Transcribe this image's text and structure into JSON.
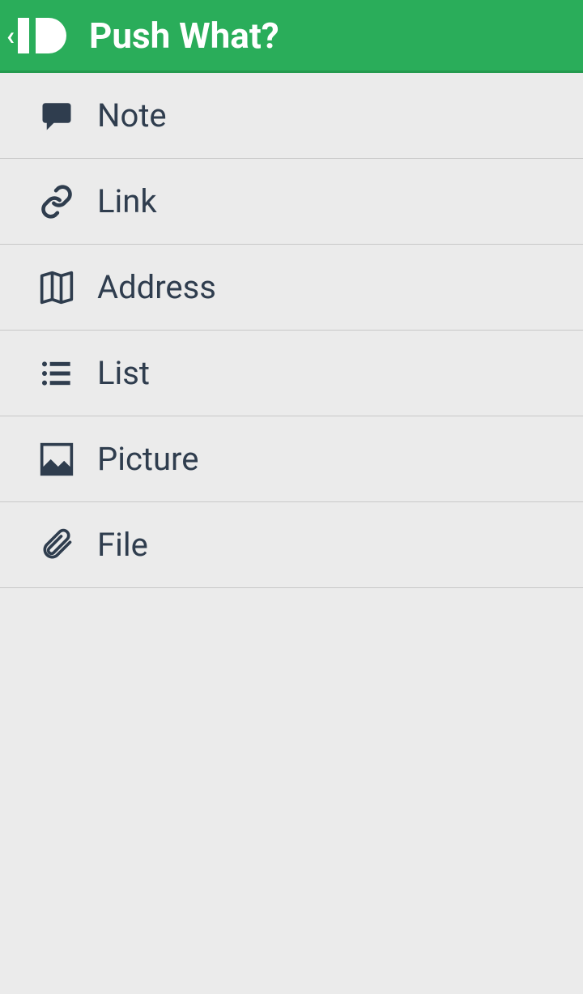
{
  "header": {
    "title": "Push What?"
  },
  "items": [
    {
      "label": "Note",
      "icon": "note"
    },
    {
      "label": "Link",
      "icon": "link"
    },
    {
      "label": "Address",
      "icon": "address"
    },
    {
      "label": "List",
      "icon": "list"
    },
    {
      "label": "Picture",
      "icon": "picture"
    },
    {
      "label": "File",
      "icon": "file"
    }
  ]
}
